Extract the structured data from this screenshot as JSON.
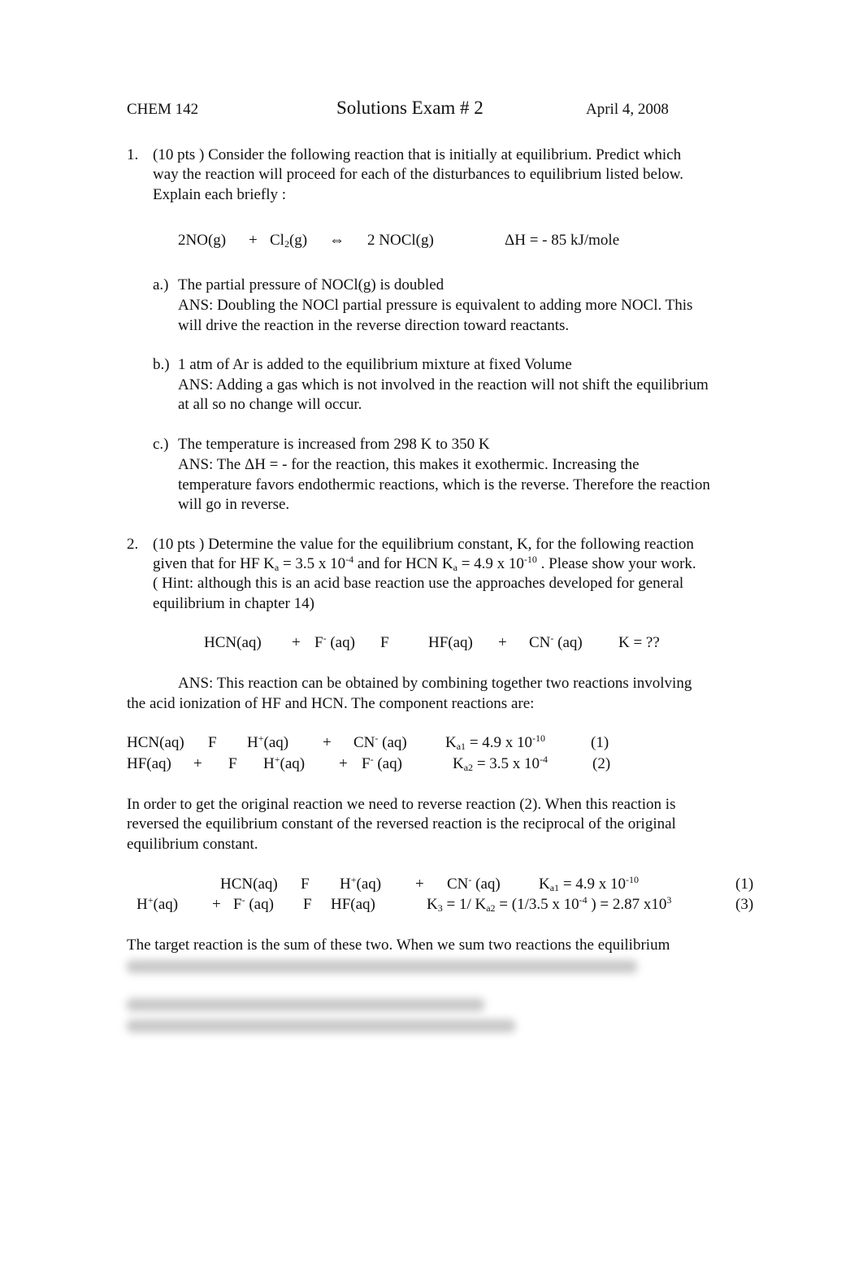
{
  "header": {
    "course": [
      "CHEM 142"
    ],
    "title": [
      "Solutions  Exam # 2"
    ],
    "date": [
      "April 4, 2008"
    ]
  },
  "q1": {
    "number": [
      "1."
    ],
    "prompt": [
      [
        "(10 pts ) Consider the following reaction that is initially at equilibrium.   Predict which"
      ],
      [
        "way the reaction will proceed for each of the disturbances to equilibrium listed below."
      ],
      [
        "Explain each briefly :"
      ]
    ],
    "equation": [
      [
        "2NO(g)"
      ],
      [
        "+"
      ],
      [
        "Cl",
        {
          "sub": "2"
        },
        "(g)"
      ],
      [
        "⇔"
      ],
      [
        "2 NOCl(g)"
      ],
      [
        "ΔH = - 85 kJ/mole"
      ]
    ],
    "parts": [
      {
        "label": [
          "a.)"
        ],
        "lines": [
          [
            "The partial pressure of NOCl(g) is doubled"
          ],
          [
            "ANS:  Doubling the NOCl partial pressure is equivalent to adding more NOCl.  This"
          ],
          [
            "will drive the reaction in the reverse direction toward reactants."
          ]
        ]
      },
      {
        "label": [
          "b.)"
        ],
        "lines": [
          [
            "1 atm of Ar is added to the equilibrium mixture at fixed Volume"
          ],
          [
            "ANS:  Adding a gas which is not involved in the reaction will not shift the equilibrium"
          ],
          [
            "at all so no change will occur."
          ]
        ]
      },
      {
        "label": [
          "c.)"
        ],
        "lines": [
          [
            "The temperature is increased from 298 K to 350 K"
          ],
          [
            "ANS:  The ΔH = - for the reaction, this makes it exothermic.  Increasing the"
          ],
          [
            "temperature favors endothermic reactions, which is the reverse.  Therefore the reaction"
          ],
          [
            "will go in reverse."
          ]
        ]
      }
    ]
  },
  "q2": {
    "number": [
      "2."
    ],
    "prompt": [
      [
        "(10 pts ) Determine the value for the equilibrium constant, K,  for the following reaction"
      ],
      [
        "given that for HF K",
        {
          "sub": "a"
        },
        " = 3.5 x 10",
        {
          "sup": "-4"
        },
        "  and for HCN K",
        {
          "sub": "a"
        },
        " = 4.9 x 10",
        {
          "sup": "-10"
        },
        "  .  Please show your work."
      ],
      [
        "( Hint: although this is an acid base reaction use the approaches developed for general"
      ],
      [
        "equilibrium in chapter 14)"
      ]
    ],
    "equation": [
      [
        "HCN(aq)"
      ],
      [
        "+"
      ],
      [
        "F",
        {
          "sup": "-"
        },
        " (aq)"
      ],
      [
        "F"
      ],
      [
        "HF(aq)"
      ],
      [
        "+"
      ],
      [
        "CN",
        {
          "sup": "-"
        },
        " (aq)"
      ],
      [
        "K = ??"
      ]
    ],
    "ans_intro": [
      [
        "ANS:  This reaction can be obtained by combining together two reactions involving"
      ],
      [
        "the acid ionization of HF and HCN.  The component reactions are:"
      ]
    ],
    "reaction1": [
      [
        "HCN(aq)"
      ],
      [
        "F"
      ],
      [
        "H",
        {
          "sup": "+"
        },
        "(aq)"
      ],
      [
        "+"
      ],
      [
        "CN",
        {
          "sup": "-"
        },
        " (aq)"
      ],
      [
        "K",
        {
          "sub": "a1"
        },
        " =  4.9 x 10",
        {
          "sup": "-10"
        }
      ],
      [
        "(1)"
      ]
    ],
    "reaction2": [
      [
        "HF(aq)"
      ],
      [
        "+"
      ],
      [
        "F"
      ],
      [
        "H",
        {
          "sup": "+"
        },
        "(aq)"
      ],
      [
        "+"
      ],
      [
        "F",
        {
          "sup": "-"
        },
        " (aq)"
      ],
      [
        "K",
        {
          "sub": "a2"
        },
        " =  3.5 x 10",
        {
          "sup": "-4"
        }
      ],
      [
        "(2)"
      ]
    ],
    "reverse_paragraph": [
      [
        "In order to get the original reaction we need to reverse reaction (2).  When this reaction is"
      ],
      [
        "reversed the equilibrium constant of the reversed reaction is the reciprocal of the original"
      ],
      [
        "equilibrium constant."
      ]
    ],
    "reaction1b": [
      [
        "HCN(aq)"
      ],
      [
        "F"
      ],
      [
        "H",
        {
          "sup": "+"
        },
        "(aq)"
      ],
      [
        "+"
      ],
      [
        "CN",
        {
          "sup": "-"
        },
        " (aq)"
      ],
      [
        "K",
        {
          "sub": "a1"
        },
        " =  4.9 x 10",
        {
          "sup": "-10"
        }
      ],
      [
        "(1)"
      ]
    ],
    "reaction3": [
      [
        "H",
        {
          "sup": "+"
        },
        "(aq)"
      ],
      [
        "+"
      ],
      [
        "F",
        {
          "sup": "-"
        },
        " (aq)"
      ],
      [
        "F"
      ],
      [
        "HF(aq)"
      ],
      [
        "K",
        {
          "sub": "3"
        },
        " =  1/ K",
        {
          "sub": "a2"
        },
        " = (1/3.5 x 10",
        {
          "sup": "-4"
        },
        " )  =  2.87 x10",
        {
          "sup": "3"
        }
      ],
      [
        "(3)"
      ]
    ],
    "sum_line": [
      [
        "The target reaction is the sum of these two.  When we sum two reactions the equilibrium"
      ]
    ]
  }
}
